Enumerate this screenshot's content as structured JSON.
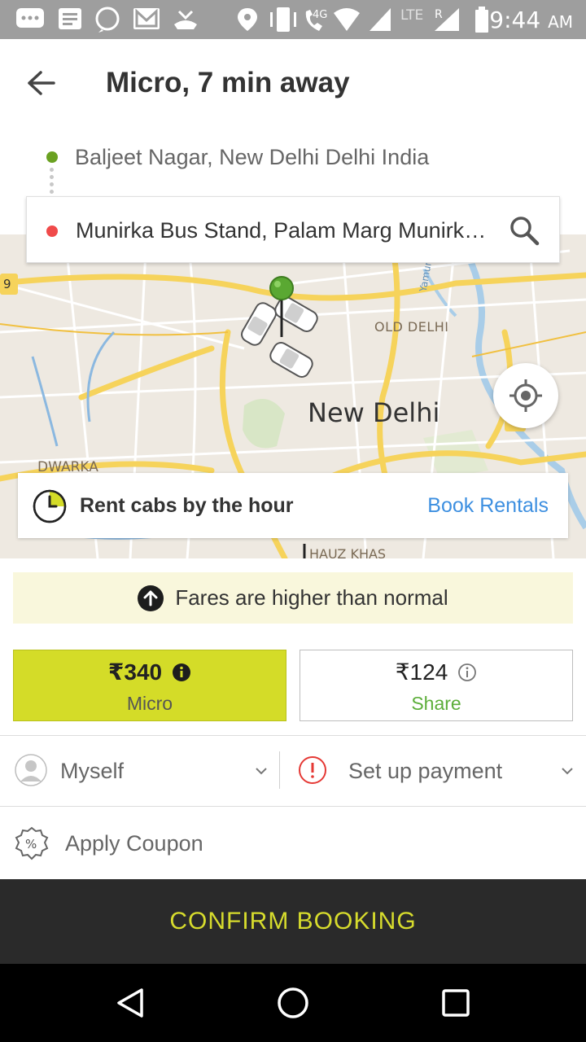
{
  "status_bar": {
    "time": "9:44",
    "ampm": "AM",
    "network_label_4g": "4G",
    "network_label_lte": "LTE",
    "roaming_label": "R",
    "icons": [
      "chat-icon",
      "message-icon",
      "whatsapp-icon",
      "gmail-icon",
      "missed-call-icon",
      "location-icon",
      "vibrate-icon",
      "volte-call-icon",
      "wifi-icon",
      "signal-icon",
      "battery-icon"
    ]
  },
  "header": {
    "title": "Micro, 7 min away",
    "pickup": "Baljeet Nagar, New Delhi Delhi India",
    "destination": "Munirka Bus Stand, Palam Marg Munirka Vasant Vihar"
  },
  "map": {
    "labels": {
      "old_delhi": "OLD DELHI",
      "new_delhi": "New Delhi",
      "dwarka": "DWARKA",
      "hauz_khas": "HAUZ KHAS",
      "yamuna": "Yamuna",
      "highway_badge": "9"
    },
    "pin_color": "#5aa832"
  },
  "rental": {
    "text": "Rent cabs by the hour",
    "link": "Book Rentals"
  },
  "fare_notice": {
    "text": "Fares are higher than normal"
  },
  "fares": {
    "micro": {
      "price": "₹340",
      "name": "Micro",
      "selected": true
    },
    "share": {
      "price": "₹124",
      "name": "Share",
      "selected": false
    }
  },
  "rider": {
    "label": "Myself"
  },
  "payment": {
    "label": "Set up payment"
  },
  "coupon": {
    "label": "Apply Coupon"
  },
  "confirm": {
    "label": "CONFIRM BOOKING"
  },
  "colors": {
    "accent_yellow": "#d4dc28",
    "confirm_text": "#d7dc2d",
    "link_blue": "#3d8fe0",
    "pickup_green": "#6aa121",
    "drop_red": "#f04a4a",
    "share_green": "#5cae3a"
  }
}
